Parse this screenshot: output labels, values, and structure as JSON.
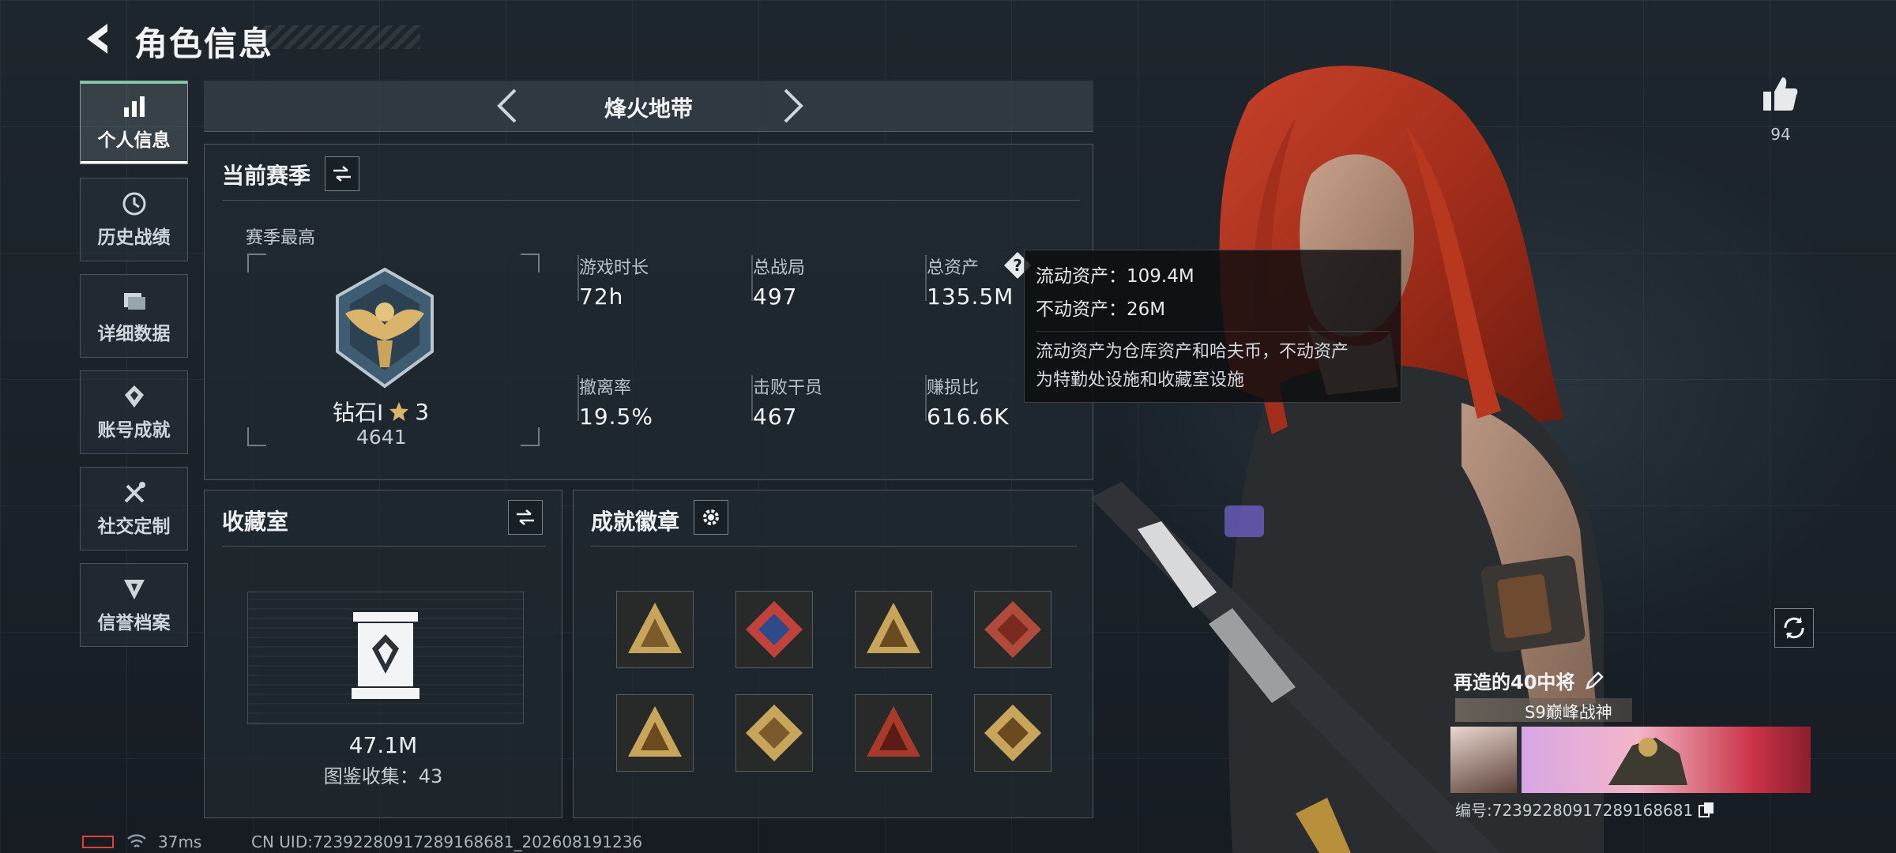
{
  "header": {
    "title": "角色信息"
  },
  "sidebar": {
    "items": [
      {
        "label": "个人信息",
        "icon": "bar-chart-icon",
        "active": true
      },
      {
        "label": "历史战绩",
        "icon": "history-icon",
        "active": false
      },
      {
        "label": "详细数据",
        "icon": "folder-icon",
        "active": false
      },
      {
        "label": "账号成就",
        "icon": "achievement-icon",
        "active": false
      },
      {
        "label": "社交定制",
        "icon": "tools-icon",
        "active": false
      },
      {
        "label": "信誉档案",
        "icon": "shield-icon",
        "active": false
      }
    ]
  },
  "mode": {
    "title": "烽火地带"
  },
  "season": {
    "heading": "当前赛季",
    "best_label": "赛季最高",
    "rank_name": "钻石I",
    "rank_stars": "3",
    "rank_points": "4641",
    "stats": [
      {
        "label": "游戏时长",
        "value": "72h"
      },
      {
        "label": "总战局",
        "value": "497"
      },
      {
        "label": "总资产",
        "value": "135.5M"
      },
      {
        "label": "撤离率",
        "value": "19.5%"
      },
      {
        "label": "击败干员",
        "value": "467"
      },
      {
        "label": "赚损比",
        "value": "616.6K"
      }
    ]
  },
  "tooltip": {
    "liquid": "流动资产：109.4M",
    "fixed": "不动资产：26M",
    "desc_line1": "流动资产为仓库资产和哈夫币，不动资产",
    "desc_line2": "为特勤处设施和收藏室设施"
  },
  "collection": {
    "heading": "收藏室",
    "value": "47.1M",
    "count": "图鉴收集：43"
  },
  "badges": {
    "heading": "成就徽章",
    "items": [
      "badge-icon-1",
      "badge-icon-2",
      "badge-icon-3",
      "badge-icon-4",
      "badge-icon-5",
      "badge-icon-6",
      "badge-icon-7",
      "badge-icon-8"
    ]
  },
  "likes": {
    "count": "94"
  },
  "profile": {
    "name": "再造的40中将",
    "title": "S9巅峰战神",
    "id_text": "编号:7239228091728916868​1"
  },
  "footer": {
    "ping": "37ms",
    "uid": "CN UID:7239228091728916868​1_202608191236"
  },
  "colors": {
    "accent": "#7fd3a0",
    "panel": "#212930",
    "tooltip_bg": "#0c0e10",
    "hair": "#b5301f"
  }
}
